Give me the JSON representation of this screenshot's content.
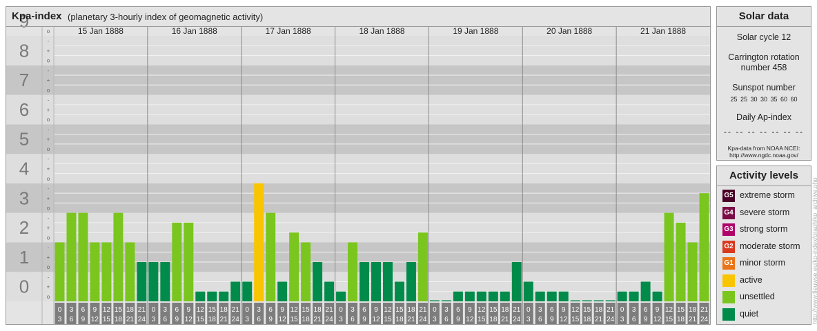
{
  "header": {
    "title": "Kpa-index",
    "subtitle": "(planetary 3-hourly index of geomagnetic activity)"
  },
  "chart_data": {
    "type": "bar",
    "title": "Kpa-index",
    "subtitle": "(planetary 3-hourly index of geomagnetic activity)",
    "y_ticks": [
      "0",
      "1",
      "2",
      "3",
      "4",
      "5",
      "6",
      "7",
      "8",
      "9"
    ],
    "y_minor_ticks": [
      "o",
      "+",
      "-",
      "o",
      "+",
      "-",
      "o",
      "+",
      "-",
      "o",
      "+",
      "-",
      "o",
      "+",
      "-",
      "o",
      "+",
      "-",
      "o",
      "+",
      "-",
      "o",
      "+",
      "-",
      "o",
      "+",
      "-",
      "o"
    ],
    "ylim": [
      0,
      9
    ],
    "days": [
      "15 Jan 1888",
      "16 Jan 1888",
      "17 Jan 1888",
      "18 Jan 1888",
      "19 Jan 1888",
      "20 Jan 1888",
      "21 Jan 1888"
    ],
    "interval_start": [
      "0",
      "3",
      "6",
      "9",
      "12",
      "15",
      "18",
      "21"
    ],
    "interval_end": [
      "3",
      "6",
      "9",
      "12",
      "15",
      "18",
      "21",
      "24"
    ],
    "values": [
      2.0,
      3.0,
      3.0,
      2.0,
      2.0,
      3.0,
      2.0,
      1.333,
      1.333,
      1.333,
      2.667,
      2.667,
      0.333,
      0.333,
      0.333,
      0.667,
      0.667,
      4.0,
      3.0,
      0.667,
      2.333,
      2.0,
      1.333,
      0.667,
      0.333,
      2.0,
      1.333,
      1.333,
      1.333,
      0.667,
      1.333,
      2.333,
      0.0,
      0.0,
      0.333,
      0.333,
      0.333,
      0.333,
      0.333,
      1.333,
      0.667,
      0.333,
      0.333,
      0.333,
      0.0,
      0.0,
      0.0,
      0.0,
      0.333,
      0.333,
      0.667,
      0.333,
      3.0,
      2.667,
      2.0,
      3.667
    ],
    "level_colors": {
      "quiet": "#008b4a",
      "unsettled": "#7ac61e",
      "active": "#f9c500"
    },
    "grid": true,
    "legend_position": "right"
  },
  "solar": {
    "title": "Solar data",
    "cycle": "Solar cycle 12",
    "carrington_line1": "Carrington rotation",
    "carrington_line2": "number 458",
    "sunspot_label": "Sunspot number",
    "sunspot_values": "25 25 30 30 35 60 60",
    "ap_label": "Daily Ap-index",
    "ap_values": "-- -- -- -- -- -- --",
    "credit_line1": "Kpa-data from NOAA NCEI:",
    "credit_line2": "http://www.ngdc.noaa.gov/"
  },
  "activity": {
    "title": "Activity levels",
    "items": [
      {
        "code": "G5",
        "label": "extreme storm",
        "color": "#4a0026"
      },
      {
        "code": "G4",
        "label": "severe storm",
        "color": "#7b0c45"
      },
      {
        "code": "G3",
        "label": "strong storm",
        "color": "#b0006b"
      },
      {
        "code": "G2",
        "label": "moderate storm",
        "color": "#d93a1e"
      },
      {
        "code": "G1",
        "label": "minor storm",
        "color": "#ea7418"
      },
      {
        "code": "",
        "label": "active",
        "color": "#f9c500"
      },
      {
        "code": "",
        "label": "unsettled",
        "color": "#7ac61e"
      },
      {
        "code": "",
        "label": "quiet",
        "color": "#008b4a"
      }
    ]
  },
  "watermark": "http://www.fieuwse.eu/kp-index/graph/kp_archive.php"
}
